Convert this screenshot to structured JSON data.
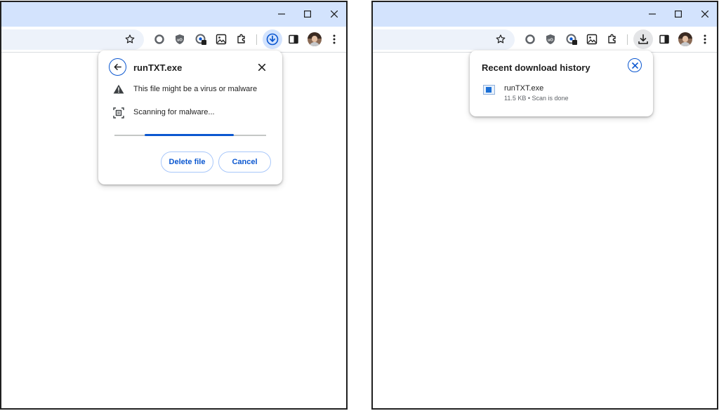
{
  "left_window": {
    "popup": {
      "title": "runTXT.exe",
      "warning_text": "This file might be a virus or malware",
      "scanning_text": "Scanning for malware...",
      "delete_label": "Delete file",
      "cancel_label": "Cancel",
      "progress_state": "indeterminate"
    }
  },
  "right_window": {
    "popup": {
      "title": "Recent download history",
      "file_name": "runTXT.exe",
      "file_meta": "11.5 KB • Scan is done"
    }
  },
  "toolbar_icons": [
    "bookmark-star-icon",
    "extension-circle-icon",
    "ublock-icon",
    "extension-badge-icon",
    "image-icon",
    "extensions-puzzle-icon",
    "download-icon",
    "side-panel-icon",
    "avatar",
    "menu-icon"
  ],
  "window_controls": [
    "minimize-icon",
    "maximize-icon",
    "close-icon"
  ],
  "colors": {
    "titlebar": "#d3e3fd",
    "omnibox": "#edf2fa",
    "accent": "#0b57d0",
    "progress_track": "#c4c7c5"
  }
}
